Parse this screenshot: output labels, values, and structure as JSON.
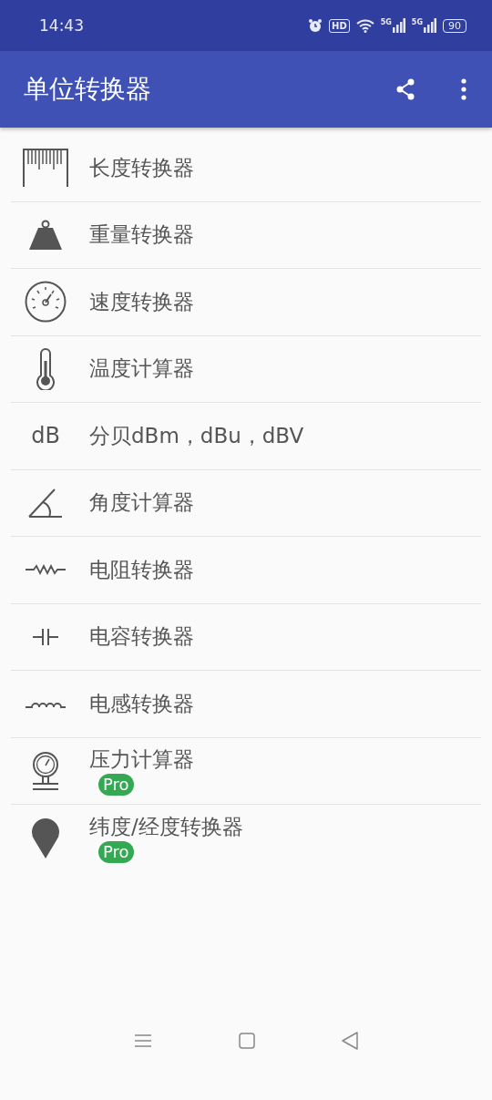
{
  "status_bar": {
    "time": "14:43",
    "hd": "HD",
    "signals": [
      "5G",
      "5G"
    ],
    "battery": "90"
  },
  "app_bar": {
    "title": "单位转换器"
  },
  "items": [
    {
      "kind": "ruler",
      "label": "长度转换器"
    },
    {
      "kind": "weight",
      "label": "重量转换器"
    },
    {
      "kind": "speedometer",
      "label": "速度转换器"
    },
    {
      "kind": "thermometer",
      "label": "温度计算器"
    },
    {
      "kind": "text",
      "icon_text": "dB",
      "label": "分贝dBm，dBu，dBV"
    },
    {
      "kind": "angle",
      "label": "角度计算器"
    },
    {
      "kind": "resistor",
      "label": "电阻转换器"
    },
    {
      "kind": "capacitor",
      "label": "电容转换器"
    },
    {
      "kind": "inductor",
      "label": "电感转换器"
    },
    {
      "kind": "gauge",
      "label": "压力计算器",
      "badge": "Pro"
    },
    {
      "kind": "pin",
      "label": "纬度/经度转换器",
      "badge": "Pro"
    }
  ]
}
